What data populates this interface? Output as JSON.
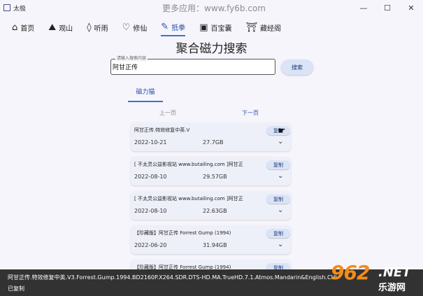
{
  "window": {
    "title": "太极",
    "watermark_top": "更多应用：www.fy6b.com",
    "buttons": [
      "—",
      "☐",
      "✕"
    ]
  },
  "nav": [
    {
      "label": "首页",
      "icon": "home-icon",
      "glyph": "⌂"
    },
    {
      "label": "观山",
      "icon": "mountain-icon",
      "glyph": "⛰"
    },
    {
      "label": "听雨",
      "icon": "drop-icon",
      "glyph": "◊"
    },
    {
      "label": "修仙",
      "icon": "heart-icon",
      "glyph": "♡"
    },
    {
      "label": "抵拳",
      "icon": "edit-icon",
      "glyph": "✎",
      "active": true
    },
    {
      "label": "百宝囊",
      "icon": "bag-icon",
      "glyph": "▣"
    },
    {
      "label": "藏经阁",
      "icon": "temple-icon",
      "glyph": "⛩"
    }
  ],
  "page_title": "聚合磁力搜索",
  "search": {
    "label": "请输入搜索内容",
    "value": "阿甘正传",
    "button": "搜索"
  },
  "tab": "磁力猫",
  "pagination": {
    "prev": "上一页",
    "next": "下一页"
  },
  "results": [
    {
      "title": "阿甘正传.特效修复中英.V",
      "date": "2022-10-21",
      "size": "27.7GB",
      "copy": "复制"
    },
    {
      "title": "[ 不太灵公益影视站 www.butailing.com ]阿甘正",
      "date": "2022-08-10",
      "size": "29.57GB",
      "copy": "复制"
    },
    {
      "title": "[ 不太灵公益影视站 www.butailing.com ]阿甘正",
      "date": "2022-08-10",
      "size": "22.63GB",
      "copy": "复制"
    },
    {
      "title": "【珍藏版】阿甘正传 Forrest Gump (1994)",
      "date": "2022-06-20",
      "size": "31.94GB",
      "copy": "复制"
    },
    {
      "title": "【珍藏版】阿甘正传 Forrest Gump (1994)",
      "date": "",
      "size": "",
      "copy": "复制"
    }
  ],
  "snackbar": {
    "line1": "阿甘正传.特效修复中英.V3.Forrest.Gump.1994.BD2160P.X264.SDR.DTS-HD.MA.TrueHD.7.1.Atmos.Mandarin&English.CHS-ENG",
    "line2": "已复制"
  },
  "watermark_logo": {
    "big": "962",
    "net": ".NET",
    "cn": "乐游网"
  }
}
